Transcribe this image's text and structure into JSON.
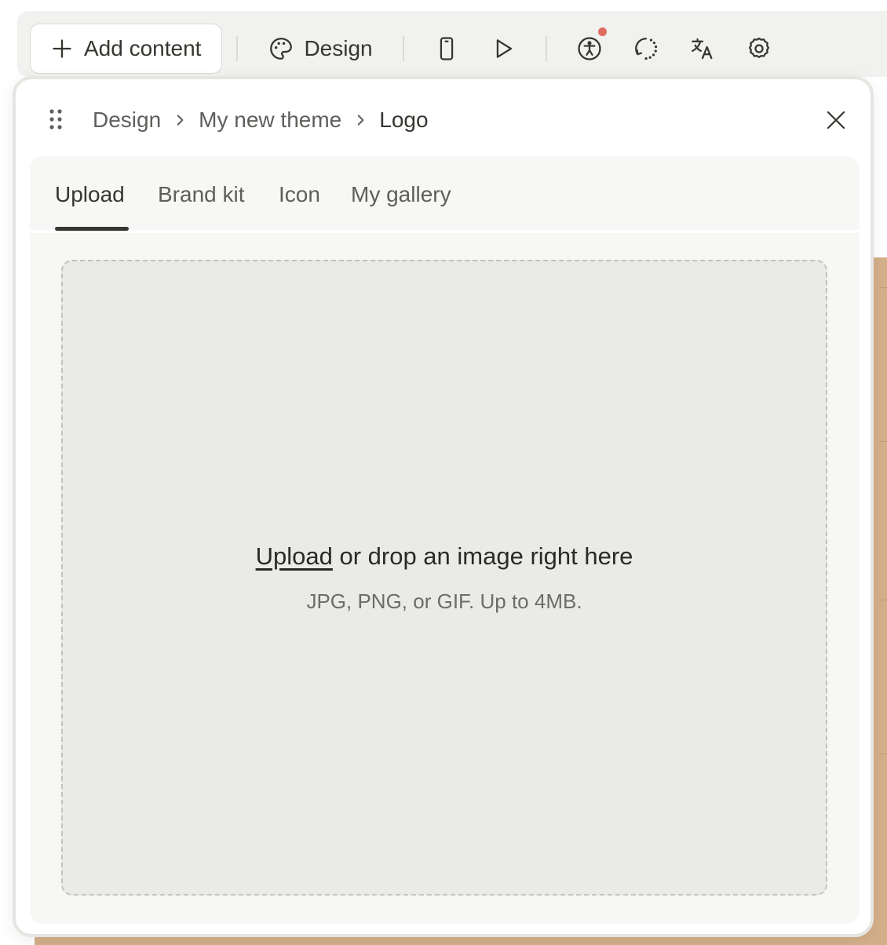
{
  "toolbar": {
    "add_content_label": "Add content",
    "design_label": "Design"
  },
  "breadcrumb": {
    "items": [
      "Design",
      "My new theme",
      "Logo"
    ]
  },
  "tabs": [
    "Upload",
    "Brand kit",
    "Icon",
    "My gallery"
  ],
  "dropzone": {
    "link_text": "Upload",
    "rest_text": "or drop an image right here",
    "hint": "JPG, PNG, or GIF. Up to 4MB."
  },
  "colors": {
    "text": "#37352f",
    "muted": "#5f5e5b",
    "notification": "#e06b5e",
    "canvas": "#d4b08a",
    "dropzone_bg": "#eaeae8"
  },
  "icons": [
    "plus-icon",
    "palette-icon",
    "mobile-preview-icon",
    "play-icon",
    "accessibility-icon",
    "loading-icon",
    "translate-icon",
    "gear-icon",
    "drag-handle-icon",
    "chevron-right-icon",
    "close-icon"
  ]
}
